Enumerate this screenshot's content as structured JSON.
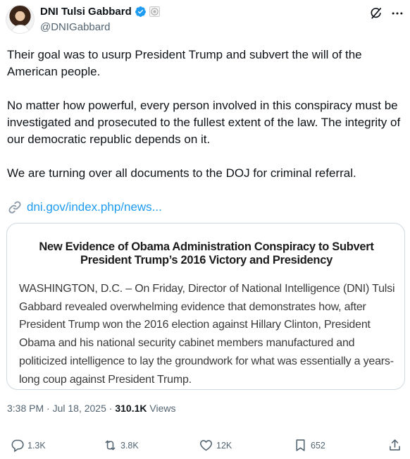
{
  "post": {
    "author": {
      "display_name": "DNI Tulsi Gabbard",
      "handle": "@DNIGabbard",
      "verified_icon": "verified-check-icon",
      "affiliation_icon": "government-badge-icon"
    },
    "body": {
      "p1": "Their goal was to usurp President Trump and subvert the will of the American people.",
      "p2": "No matter how powerful, every person involved in this conspiracy must be investigated and prosecuted to the fullest extent of the law. The integrity of our democratic republic depends on it.",
      "p3": "We are turning over all documents to the DOJ for criminal referral."
    },
    "link": {
      "icon": "link-icon",
      "text": "dni.gov/index.php/news..."
    },
    "card": {
      "title": "New Evidence of Obama Administration Conspiracy to Subvert President Trump’s 2016 Victory and Presidency",
      "body": "WASHINGTON, D.C. – On Friday, Director of National Intelligence (DNI) Tulsi Gabbard revealed overwhelming evidence that demonstrates how, after President Trump won the 2016 election against Hillary Clinton, President Obama and his national security cabinet members manufactured and politicized intelligence to lay the groundwork for what was essentially a years-long coup against President Trump."
    },
    "meta": {
      "time": "3:38 PM",
      "separator": " · ",
      "date": "Jul 18, 2025",
      "views_count": "310.1K",
      "views_label": " Views"
    },
    "actions": {
      "replies": "1.3K",
      "reposts": "3.8K",
      "likes": "12K",
      "bookmarks": "652"
    },
    "colors": {
      "link": "#1d9bf0",
      "verified": "#1d9bf0",
      "secondary_text": "#536471"
    }
  }
}
